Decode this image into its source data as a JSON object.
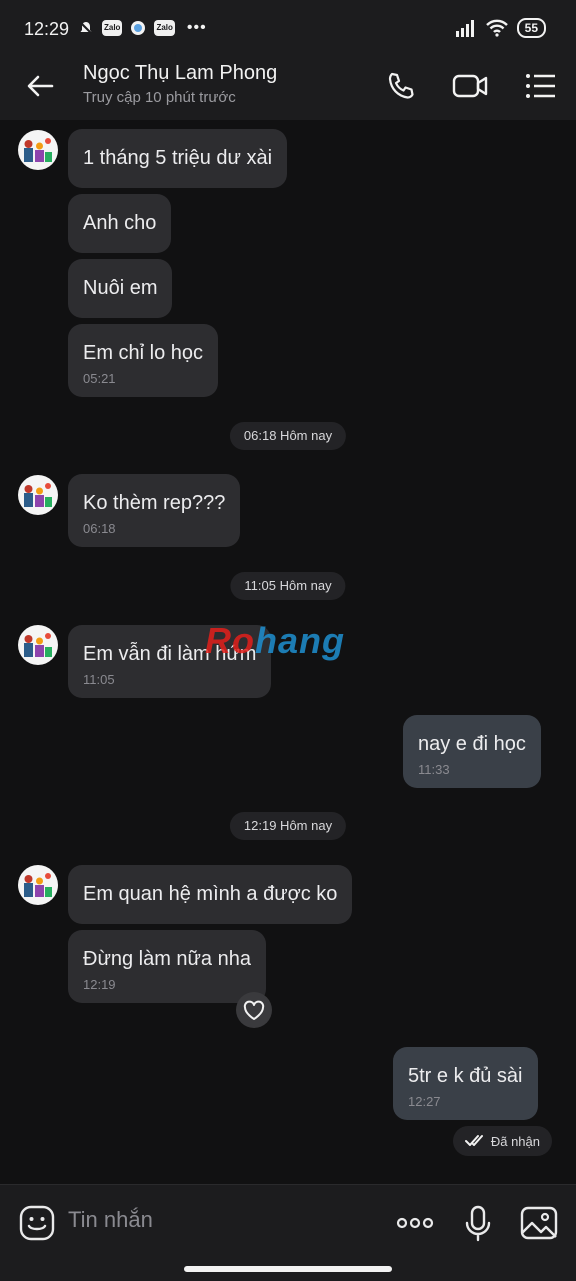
{
  "status_bar": {
    "time": "12:29",
    "notif_badges": [
      "Zalo",
      "Zalo"
    ],
    "more": "•••",
    "battery": "55"
  },
  "header": {
    "contact_name": "Ngọc Thụ Lam Phong",
    "presence": "Truy cập 10 phút trước",
    "icons": [
      "back-arrow-icon",
      "phone-icon",
      "video-call-icon",
      "menu-icon"
    ]
  },
  "messages": [
    {
      "text": "1 tháng 5 triệu dư xài"
    },
    {
      "text": "Anh cho"
    },
    {
      "text": "Nuôi em"
    },
    {
      "text": "Em chỉ lo học",
      "time": "05:21"
    },
    {
      "date": "06:18 Hôm nay"
    },
    {
      "text": "Ko thèm rep???",
      "time": "06:18"
    },
    {
      "date": "11:05 Hôm nay"
    },
    {
      "text": "Em vẫn đi làm hứm",
      "time": "11:05"
    },
    {
      "text": "nay e đi học",
      "time": "11:33"
    },
    {
      "date": "12:19 Hôm nay"
    },
    {
      "text": "Em quan hệ mình a được ko"
    },
    {
      "text": "Đừng làm nữa nha",
      "time": "12:19"
    },
    {
      "text": "5tr e k đủ sài",
      "time": "12:27"
    }
  ],
  "seen_status": "Đã nhận",
  "watermark": {
    "part1": "Ro",
    "part2": "hang"
  },
  "input": {
    "placeholder": "Tin nhắn"
  },
  "colors": {
    "bg": "#111112",
    "incoming_bubble": "#2d2d30",
    "outgoing_bubble": "#3a4048"
  }
}
